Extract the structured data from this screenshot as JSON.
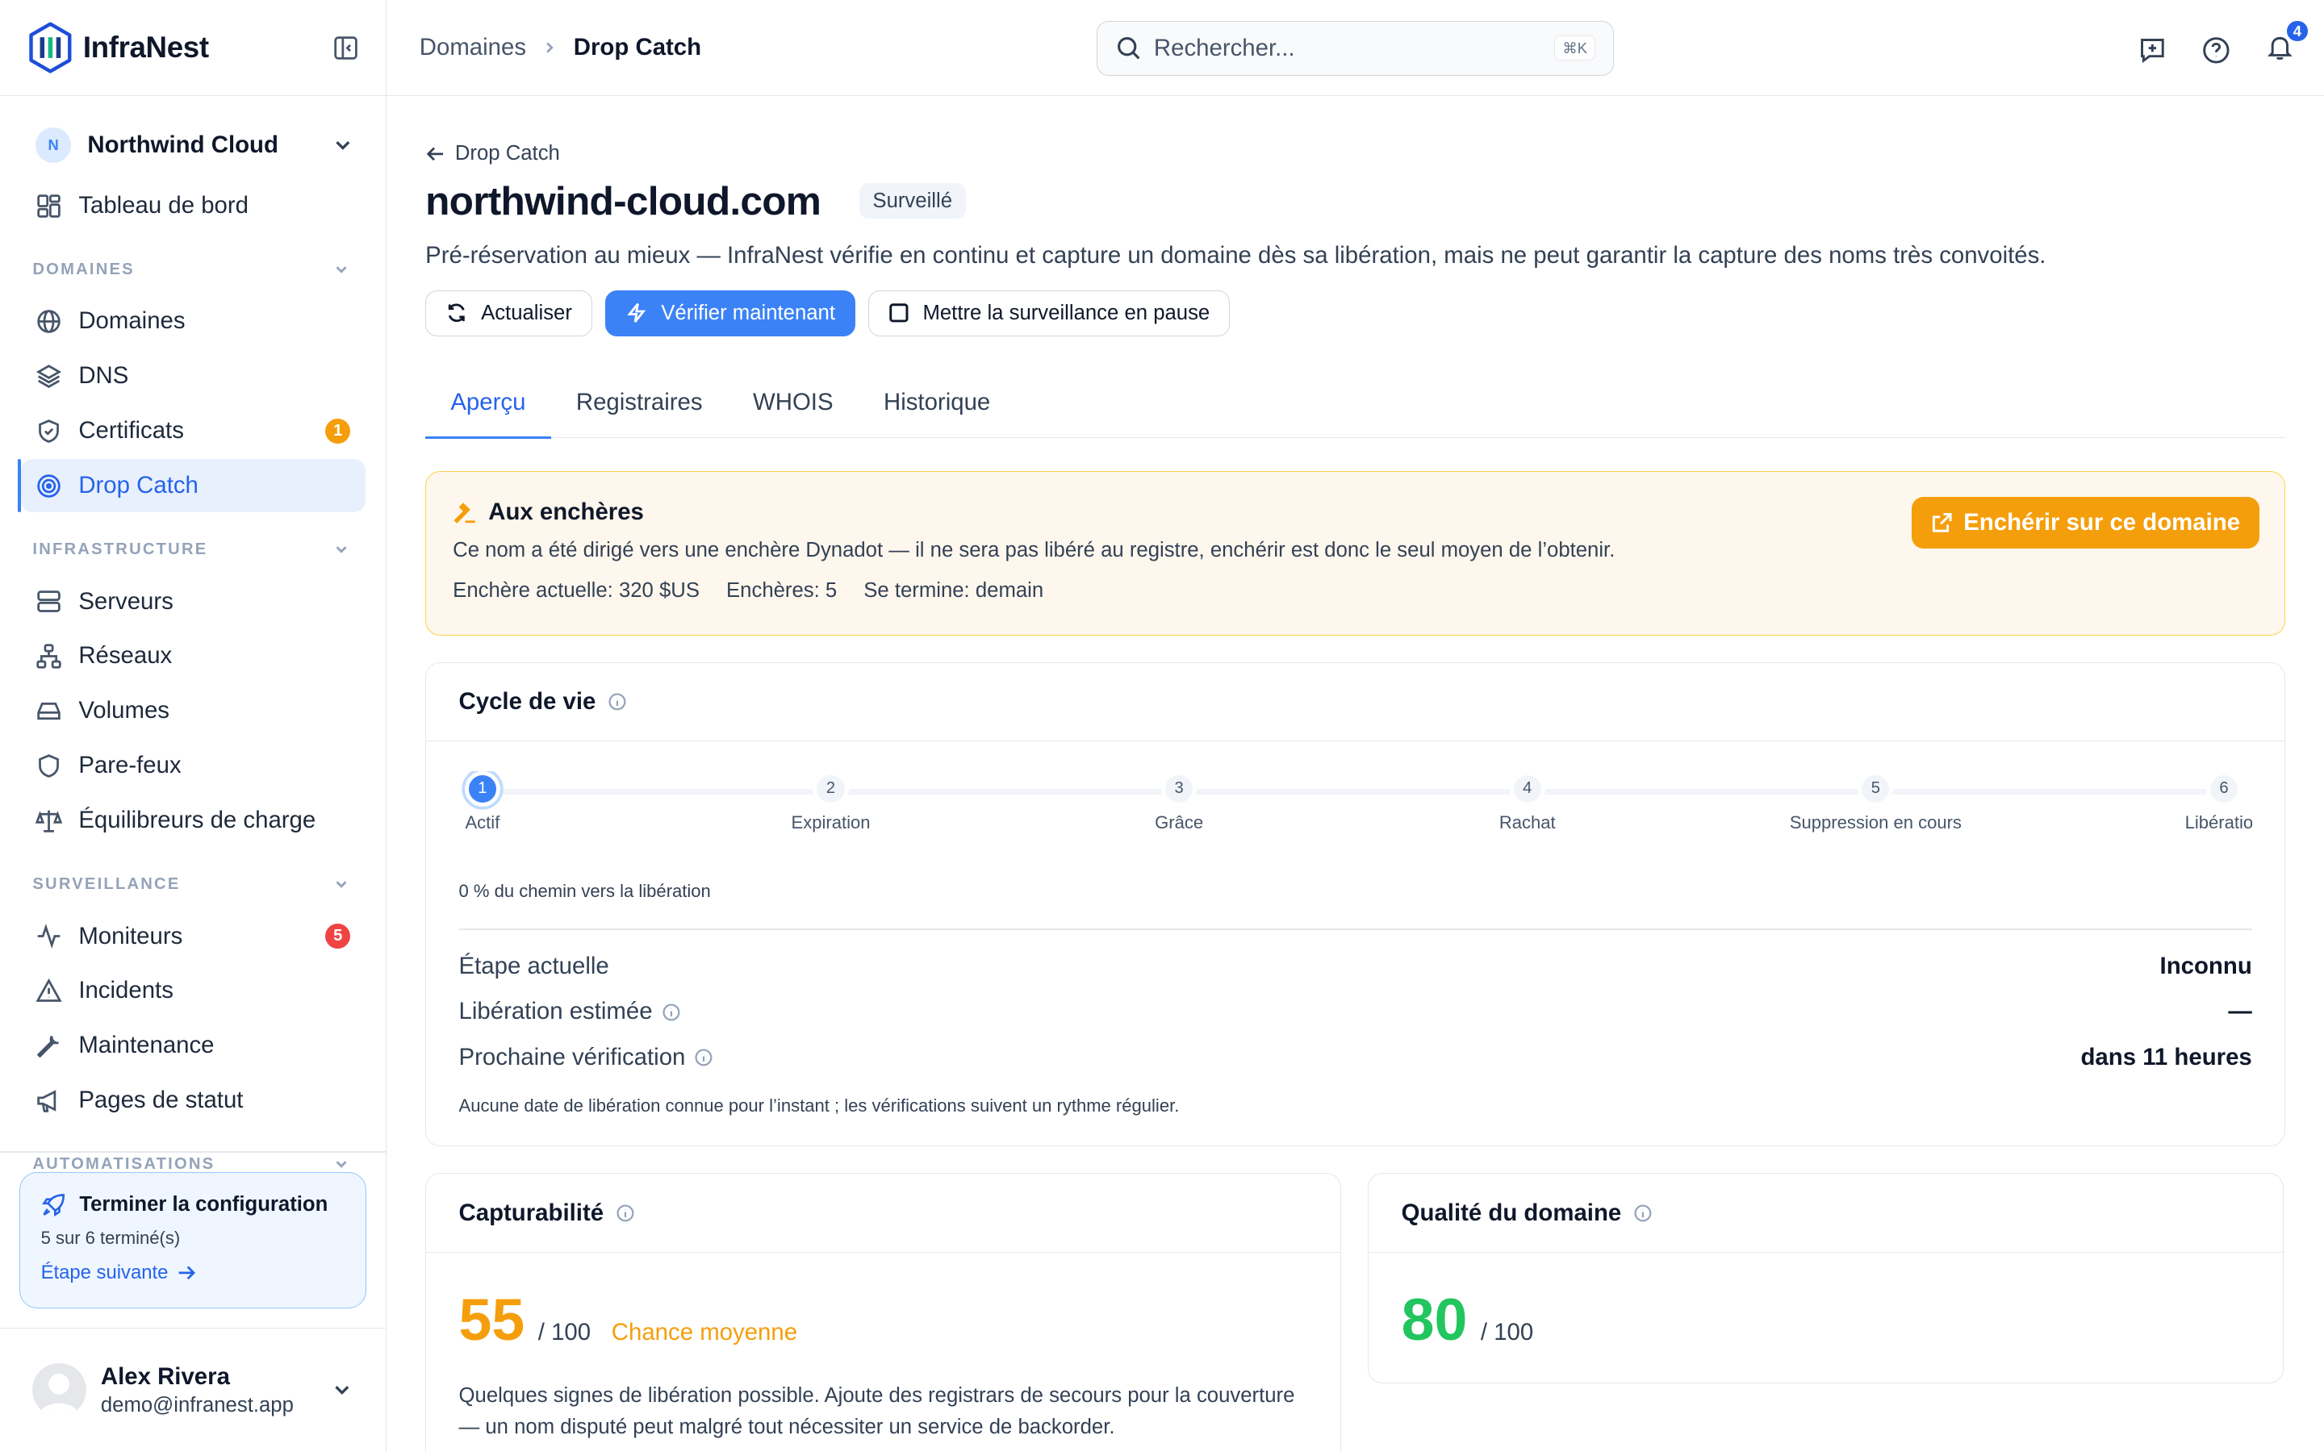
{
  "brand": {
    "name": "InfraNest"
  },
  "org": {
    "initial": "N",
    "name": "Northwind Cloud"
  },
  "sidebar": {
    "dashboard": "Tableau de bord",
    "sections": [
      {
        "title": "DOMAINES",
        "items": [
          {
            "label": "Domaines"
          },
          {
            "label": "DNS"
          },
          {
            "label": "Certificats",
            "badge": "1"
          },
          {
            "label": "Drop Catch"
          }
        ]
      },
      {
        "title": "INFRASTRUCTURE",
        "items": [
          {
            "label": "Serveurs"
          },
          {
            "label": "Réseaux"
          },
          {
            "label": "Volumes"
          },
          {
            "label": "Pare-feux"
          },
          {
            "label": "Équilibreurs de charge"
          }
        ]
      },
      {
        "title": "SURVEILLANCE",
        "items": [
          {
            "label": "Moniteurs",
            "badge": "5"
          },
          {
            "label": "Incidents"
          },
          {
            "label": "Maintenance"
          },
          {
            "label": "Pages de statut"
          }
        ]
      },
      {
        "title": "AUTOMATISATIONS",
        "items": []
      }
    ],
    "setup": {
      "title": "Terminer la configuration",
      "progress": "5 sur 6 terminé(s)",
      "link": "Étape suivante"
    }
  },
  "user": {
    "name": "Alex Rivera",
    "email": "demo@infranest.app"
  },
  "topbar": {
    "crumbs": [
      "Domaines",
      "Drop Catch"
    ],
    "search_placeholder": "Rechercher...",
    "search_shortcut": "⌘K",
    "notifications": "4"
  },
  "page": {
    "back_label": "Drop Catch",
    "title": "northwind-cloud.com",
    "status": "Surveillé",
    "description": "Pré-réservation au mieux — InfraNest vérifie en continu et capture un domaine dès sa libération, mais ne peut garantir la capture des noms très convoités.",
    "actions": {
      "refresh": "Actualiser",
      "check": "Vérifier maintenant",
      "pause": "Mettre la surveillance en pause"
    },
    "tabs": [
      "Aperçu",
      "Registraires",
      "WHOIS",
      "Historique"
    ]
  },
  "auction": {
    "title": "Aux enchères",
    "text": "Ce nom a été dirigé vers une enchère Dynadot — il ne sera pas libéré au registre, enchérir est donc le seul moyen de l’obtenir.",
    "current_bid_label": "Enchère actuelle:",
    "current_bid": "320 $US",
    "bids_label": "Enchères:",
    "bids": "5",
    "ends_label": "Se termine:",
    "ends": "demain",
    "button": "Enchérir sur ce domaine"
  },
  "lifecycle": {
    "title": "Cycle de vie",
    "steps": [
      {
        "n": "1",
        "label": "Actif"
      },
      {
        "n": "2",
        "label": "Expiration"
      },
      {
        "n": "3",
        "label": "Grâce"
      },
      {
        "n": "4",
        "label": "Rachat"
      },
      {
        "n": "5",
        "label": "Suppression en cours"
      },
      {
        "n": "6",
        "label": "Libération"
      }
    ],
    "current_step": 1,
    "progress_text": "0 % du chemin vers la libération",
    "rows": [
      {
        "k": "Étape actuelle",
        "v": "Inconnu"
      },
      {
        "k": "Libération estimée",
        "v": "—"
      },
      {
        "k": "Prochaine vérification",
        "v": "dans 11 heures"
      }
    ],
    "note": "Aucune date de libération connue pour l’instant ; les vérifications suivent un rythme régulier."
  },
  "capture": {
    "title": "Capturabilité",
    "score": "55",
    "out_of": "/ 100",
    "label": "Chance moyenne",
    "note": "Quelques signes de libération possible. Ajoute des registrars de secours pour la couverture — un nom disputé peut malgré tout nécessiter un service de backorder."
  },
  "quality": {
    "title": "Qualité du domaine",
    "score": "80",
    "out_of": "/ 100"
  },
  "colors": {
    "accent": "#3b82f6",
    "warning": "#f59e0b",
    "success": "#22c55e",
    "danger": "#ef4444"
  }
}
